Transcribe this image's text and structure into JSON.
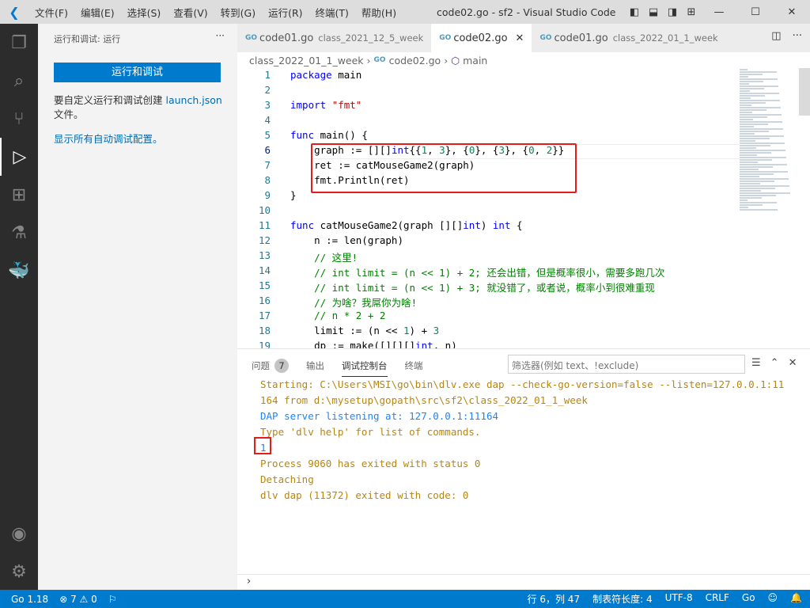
{
  "titlebar": {
    "menus": [
      "文件(F)",
      "编辑(E)",
      "选择(S)",
      "查看(V)",
      "转到(G)",
      "运行(R)",
      "终端(T)",
      "帮助(H)"
    ],
    "title": "code02.go - sf2 - Visual Studio Code"
  },
  "sidebar": {
    "header": "运行和调试: 运行",
    "run_button": "运行和调试",
    "desc_prefix": "要自定义运行和调试创建 ",
    "desc_link": "launch.json",
    "desc_suffix": "文件。",
    "show_all": "显示所有自动调试配置。"
  },
  "tabs": [
    {
      "label": "code01.go",
      "desc": "class_2021_12_5_week"
    },
    {
      "label": "code02.go",
      "desc": "",
      "active": true
    },
    {
      "label": "code01.go",
      "desc": "class_2022_01_1_week"
    }
  ],
  "breadcrumb": [
    "class_2022_01_1_week",
    "code02.go",
    "main"
  ],
  "code": [
    [
      [
        "package",
        "k"
      ],
      [
        " main",
        ""
      ]
    ],
    [],
    [
      [
        "import",
        "k"
      ],
      [
        " ",
        ""
      ],
      [
        "\"fmt\"",
        "s"
      ]
    ],
    [],
    [
      [
        "func",
        "k"
      ],
      [
        " main() {",
        ""
      ]
    ],
    [
      [
        "    graph := [][]",
        ""
      ],
      [
        "int",
        "t"
      ],
      [
        "{{",
        ""
      ],
      [
        "1",
        "n"
      ],
      [
        ", ",
        ""
      ],
      [
        "3",
        "n"
      ],
      [
        "}, {",
        ""
      ],
      [
        "0",
        "n"
      ],
      [
        "}, {",
        ""
      ],
      [
        "3",
        "n"
      ],
      [
        "}, {",
        ""
      ],
      [
        "0",
        "n"
      ],
      [
        ", ",
        ""
      ],
      [
        "2",
        "n"
      ],
      [
        "}}",
        ""
      ]
    ],
    [
      [
        "    ret := catMouseGame2(graph)",
        ""
      ]
    ],
    [
      [
        "    fmt.Println(ret)",
        ""
      ]
    ],
    [
      [
        "}",
        ""
      ]
    ],
    [],
    [
      [
        "func",
        "k"
      ],
      [
        " catMouseGame2(graph [][]",
        ""
      ],
      [
        "int",
        "t"
      ],
      [
        ") ",
        ""
      ],
      [
        "int",
        "t"
      ],
      [
        " {",
        ""
      ]
    ],
    [
      [
        "    n := len(graph)",
        ""
      ]
    ],
    [
      [
        "    // 这里!",
        "c"
      ]
    ],
    [
      [
        "    // int limit = (n << 1) + 2; 还会出错，但是概率很小，需要多跑几次",
        "c"
      ]
    ],
    [
      [
        "    // int limit = (n << 1) + 3; 就没错了，或者说，概率小到很难重现",
        "c"
      ]
    ],
    [
      [
        "    // 为啥？我屌你为啥!",
        "c"
      ]
    ],
    [
      [
        "    // n * 2 + 2",
        "c"
      ]
    ],
    [
      [
        "    limit := (n << ",
        ""
      ],
      [
        "1",
        "n"
      ],
      [
        ") + ",
        ""
      ],
      [
        "3",
        "n"
      ]
    ],
    [
      [
        "    dp := make([][][]",
        ""
      ],
      [
        "int",
        "t"
      ],
      [
        ", n)",
        ""
      ]
    ]
  ],
  "panel": {
    "tabs": [
      "问题",
      "输出",
      "调试控制台",
      "终端"
    ],
    "problems_count": "7",
    "filter_placeholder": "筛选器(例如 text、!exclude)",
    "output": [
      {
        "text": "Starting: C:\\Users\\MSI\\go\\bin\\dlv.exe dap --check-go-version=false --listen=127.0.0.1:11",
        "kind": "info"
      },
      {
        "text": "164 from d:\\mysetup\\gopath\\src\\sf2\\class_2022_01_1_week",
        "kind": "info"
      },
      {
        "text": "DAP server listening at: 127.0.0.1:11164",
        "kind": "blue"
      },
      {
        "text": "Type 'dlv help' for list of commands.",
        "kind": "info"
      },
      {
        "text": "1",
        "kind": "blue"
      },
      {
        "text": "Process 9060 has exited with status 0",
        "kind": "info"
      },
      {
        "text": "Detaching",
        "kind": "info"
      },
      {
        "text": "dlv dap (11372) exited with code: 0",
        "kind": "info"
      }
    ]
  },
  "status": {
    "go_version": "Go 1.18",
    "errors": "7",
    "warnings": "0",
    "position": "行 6，列 47",
    "tab_size": "制表符长度: 4",
    "encoding": "UTF-8",
    "eol": "CRLF",
    "language": "Go"
  },
  "colors": {
    "accent": "#007acc",
    "activity_bar": "#2c2c2c",
    "highlight_box": "#e51c1c"
  }
}
